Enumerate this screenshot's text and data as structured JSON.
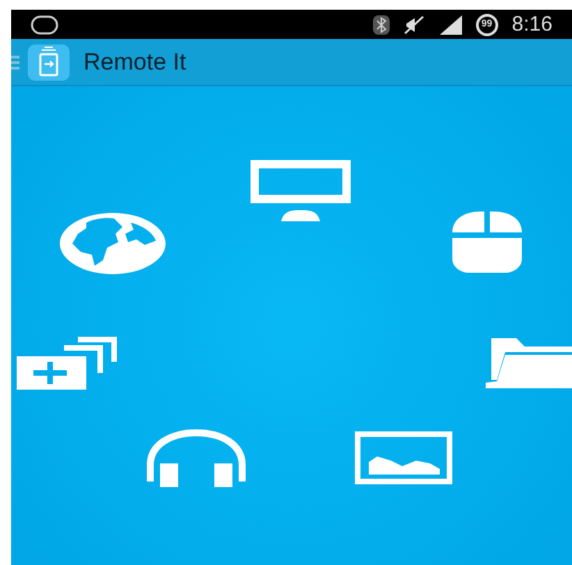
{
  "status_bar": {
    "battery": "99",
    "time": "8:16"
  },
  "app_bar": {
    "title": "Remote It"
  },
  "menu_items": [
    {
      "kind": "monitor"
    },
    {
      "kind": "globe"
    },
    {
      "kind": "mouse"
    },
    {
      "kind": "tabs"
    },
    {
      "kind": "folder"
    },
    {
      "kind": "headphones"
    },
    {
      "kind": "image"
    }
  ]
}
